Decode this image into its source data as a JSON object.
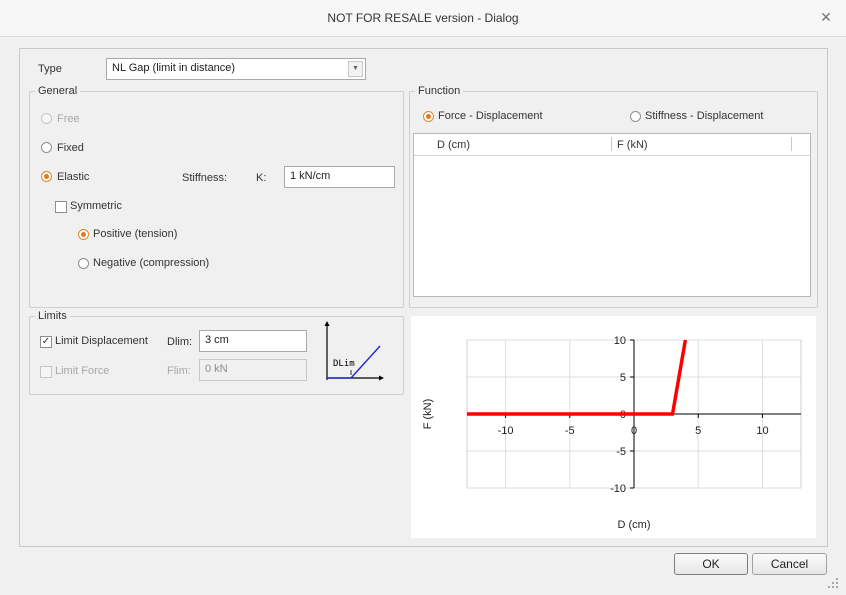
{
  "window": {
    "title": "NOT FOR RESALE version - Dialog"
  },
  "type": {
    "label": "Type",
    "value": "NL  Gap (limit in distance)"
  },
  "general": {
    "legend": "General",
    "free": "Free",
    "fixed": "Fixed",
    "elastic": "Elastic",
    "stiffness_label": "Stiffness:",
    "k_label": "K:",
    "k_value": "1 kN/cm",
    "symmetric": "Symmetric",
    "positive": "Positive (tension)",
    "negative": "Negative (compression)"
  },
  "limits": {
    "legend": "Limits",
    "limit_displacement": "Limit Displacement",
    "dlim_label": "Dlim:",
    "dlim_value": "3 cm",
    "limit_force": "Limit Force",
    "flim_label": "Flim:",
    "flim_value": "0 kN",
    "diagram_label": "DLim"
  },
  "function": {
    "legend": "Function",
    "force_displacement": "Force - Displacement",
    "stiffness_displacement": "Stiffness - Displacement",
    "columns": [
      "D (cm)",
      "F (kN)"
    ]
  },
  "buttons": {
    "ok": "OK",
    "cancel": "Cancel"
  },
  "chart_data": {
    "type": "line",
    "xlabel": "D (cm)",
    "ylabel": "F (kN)",
    "xlim": [
      -13,
      13
    ],
    "ylim": [
      -10,
      10
    ],
    "xticks": [
      -10,
      -5,
      0,
      5,
      10
    ],
    "yticks": [
      -10,
      -5,
      0,
      5,
      10
    ],
    "grid": true,
    "color": "#ff0000",
    "series": [
      {
        "x": [
          -13,
          3,
          4
        ],
        "y": [
          0,
          0,
          10
        ]
      }
    ]
  }
}
